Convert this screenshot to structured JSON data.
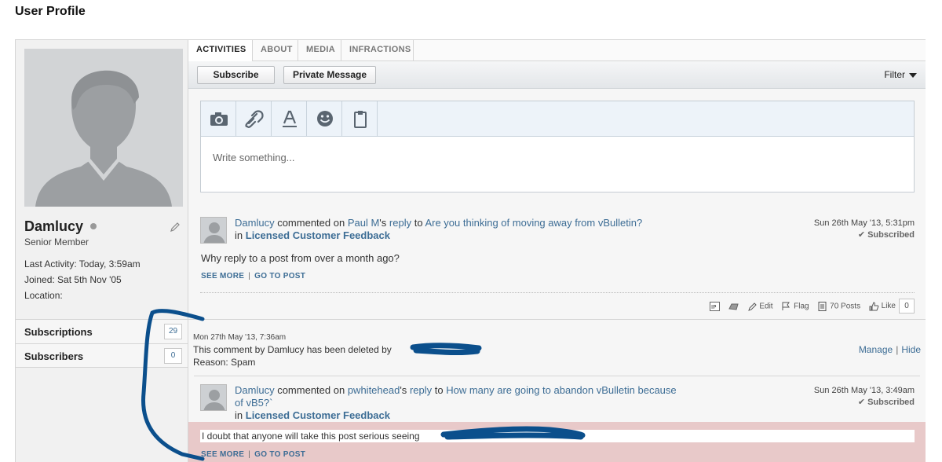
{
  "page": {
    "title": "User Profile"
  },
  "profile": {
    "username": "Damlucy",
    "rank": "Senior Member",
    "last_activity": "Last Activity: Today, 3:59am",
    "joined": "Joined: Sat 5th Nov '05",
    "location": "Location:",
    "subscriptions_label": "Subscriptions",
    "subscriptions_count": "29",
    "subscribers_label": "Subscribers",
    "subscribers_count": "0"
  },
  "tabs": [
    {
      "label": "ACTIVITIES",
      "active": true
    },
    {
      "label": "ABOUT"
    },
    {
      "label": "MEDIA"
    },
    {
      "label": "INFRACTIONS"
    }
  ],
  "toolbar": {
    "subscribe_label": "Subscribe",
    "pm_label": "Private Message",
    "filter_label": "Filter"
  },
  "editor": {
    "placeholder": "Write something...",
    "tools": [
      "camera-icon",
      "link-icon",
      "text-format-icon",
      "smiley-icon",
      "clipboard-icon"
    ]
  },
  "posts": [
    {
      "author": "Damlucy",
      "action": "commented on",
      "target_user": "Paul M",
      "possessive": "'s",
      "reply_word": "reply",
      "to_word": "to",
      "thread_title": "Are you thinking of moving away from vBulletin?",
      "in_word": "in",
      "forum": "Licensed Customer Feedback",
      "date": "Sun 26th May '13, 5:31pm",
      "subscribed": "Subscribed",
      "body": "Why reply to a post from over a month ago?",
      "see_more": "SEE MORE",
      "go_to_post": "GO TO POST",
      "actions": {
        "edit": "Edit",
        "flag": "Flag",
        "posts": "70 Posts",
        "like": "Like",
        "like_count": "0"
      }
    },
    {
      "author": "Damlucy",
      "action": "commented on",
      "target_user": "pwhitehead",
      "possessive": "'s",
      "reply_word": "reply",
      "to_word": "to",
      "thread_title_line1": "How many are going to abandon vBulletin because",
      "thread_title_line2": "of vB5?`",
      "in_word": "in",
      "forum": "Licensed Customer Feedback",
      "date": "Sun 26th May '13, 3:49am",
      "subscribed": "Subscribed",
      "body": "I doubt that anyone will take this post serious seeing",
      "see_more": "SEE MORE",
      "go_to_post": "GO TO POST"
    }
  ],
  "deleted": {
    "date": "Mon 27th May '13, 7:36am",
    "text": "This comment by Damlucy has been deleted by",
    "reason": "Reason: Spam",
    "manage": "Manage",
    "hide": "Hide"
  },
  "colors": {
    "link": "#3d6d95",
    "highlight": "#e8c9c9",
    "annotation_ink": "#0b4f8c"
  }
}
